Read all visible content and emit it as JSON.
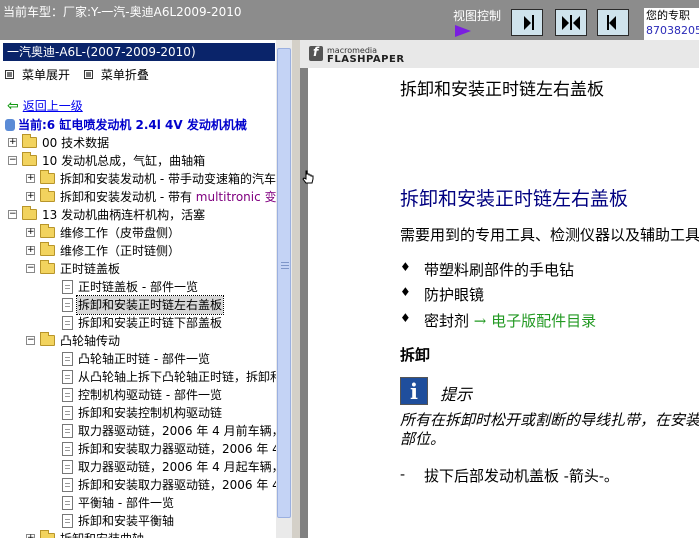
{
  "topbar": {
    "car_title": "当前车型：厂家:Y-一汽-奥迪A6L2009-2010",
    "view_control_label": "视图控制",
    "pro_box_line1": "您的专职",
    "pro_box_line2": "87038205"
  },
  "sidebar": {
    "brand_header": "一汽奥迪-A6L-(2007-2009-2010)",
    "menu_expand": "菜单展开",
    "menu_collapse": "菜单折叠",
    "back_link": "返回上一级",
    "current_path": "当前:6 缸电喷发动机  2.4l 4V 发动机机械",
    "tree": [
      {
        "label": "00 技术数据"
      },
      {
        "label": "10 发动机总成，气缸，曲轴箱"
      },
      {
        "label": "拆卸和安装发动机 - 带手动变速箱的汽车"
      },
      {
        "label": "拆卸和安装发动机 - 带有 ",
        "label_extra": "multitronic 变"
      },
      {
        "label": "13 发动机曲柄连杆机构，活塞"
      },
      {
        "label": "维修工作（皮带盘侧）"
      },
      {
        "label": "维修工作（正时链侧）"
      },
      {
        "label": "正时链盖板"
      },
      {
        "label": "正时链盖板 - 部件一览"
      },
      {
        "label": "拆卸和安装正时链左右盖板"
      },
      {
        "label": "拆卸和安装正时链下部盖板"
      },
      {
        "label": "凸轮轴传动"
      },
      {
        "label": "凸轮轴正时链 - 部件一览"
      },
      {
        "label": "从凸轮轴上拆下凸轮轴正时链，拆卸和"
      },
      {
        "label": "控制机构驱动链 - 部件一览"
      },
      {
        "label": "拆卸和安装控制机构驱动链"
      },
      {
        "label": "取力器驱动链，2006 年 4 月前车辆，"
      },
      {
        "label": "拆卸和安装取力器驱动链，2006 年 4"
      },
      {
        "label": "取力器驱动链，2006 年 4 月起车辆，"
      },
      {
        "label": "拆卸和安装取力器驱动链，2006 年 4"
      },
      {
        "label": "平衡轴 - 部件一览"
      },
      {
        "label": "拆卸和安装平衡轴"
      },
      {
        "label": "拆卸和安装曲轴"
      }
    ]
  },
  "viewer": {
    "brand_top": "macromedia",
    "brand_bottom": "FLASHPAPER",
    "page_top_title": "拆卸和安装正时链左右盖板",
    "section_title": "拆卸和安装正时链左右盖板",
    "tools_text": "需要用到的专用工具、检测仪器以及辅助工具",
    "bullet_symbol": "♦",
    "bullets": [
      {
        "text": "带塑料刷部件的手电钻"
      },
      {
        "text": "防护眼镜"
      },
      {
        "text": "密封剂 ",
        "link": "→ 电子版配件目录"
      }
    ],
    "remove_heading": "拆卸",
    "tip_label": "提示",
    "tip_line1": "所有在拆卸时松开或割断的导线扎带，在安装时",
    "tip_line2": "部位。",
    "step_dash": "-",
    "step1": "拔下后部发动机盖板 -箭头-。"
  }
}
